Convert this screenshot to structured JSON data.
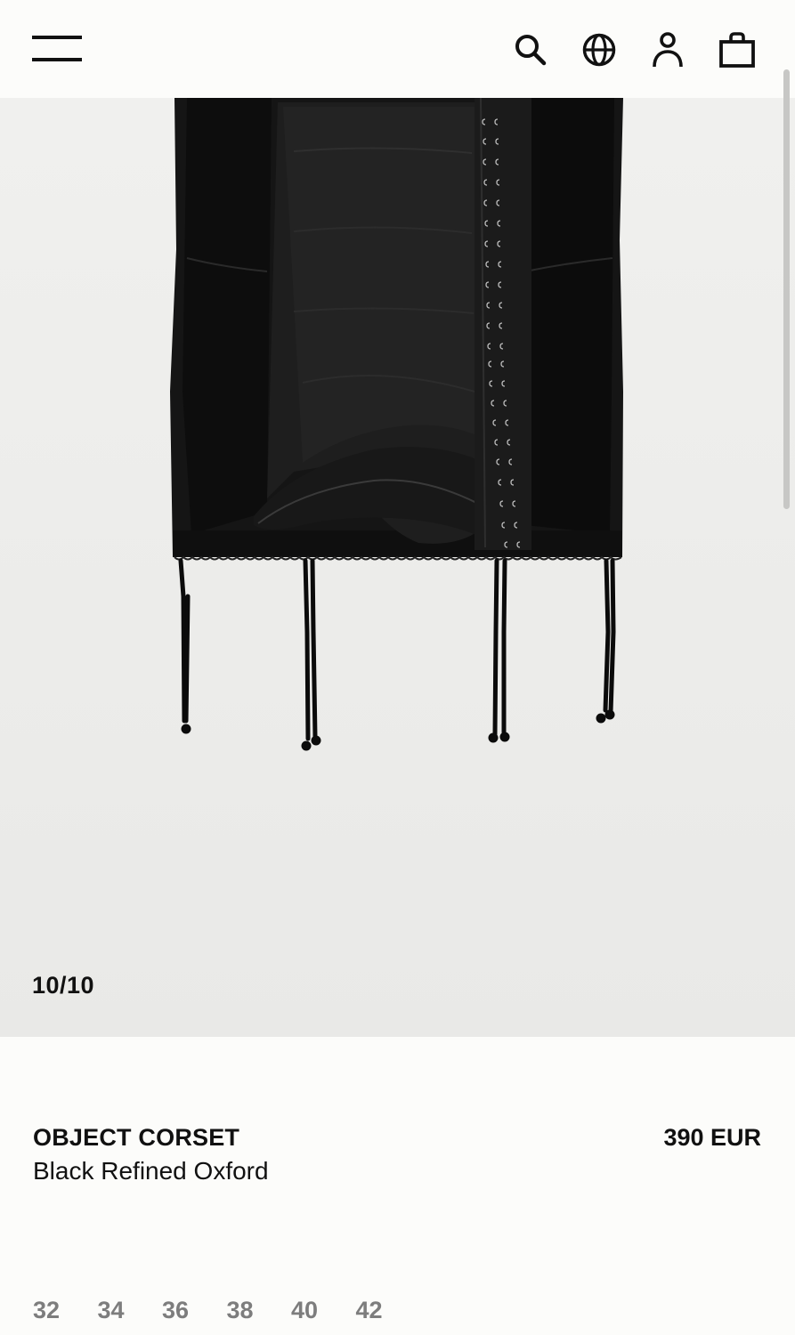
{
  "header": {
    "menu": "menu-icon",
    "search": "search-icon",
    "language": "globe-icon",
    "account": "account-icon",
    "bag": "bag-icon"
  },
  "gallery": {
    "counter": "10/10",
    "image": "black corset with hook-and-eye front and suspender straps"
  },
  "product": {
    "title": "OBJECT CORSET",
    "subtitle": "Black Refined Oxford",
    "price": "390 EUR"
  },
  "sizes": [
    "32",
    "34",
    "36",
    "38",
    "40",
    "42"
  ],
  "colors": {
    "background": "#fcfcfa",
    "gallery_bg": "#ececea",
    "text": "#111111",
    "size_text": "#7d7d7d"
  }
}
